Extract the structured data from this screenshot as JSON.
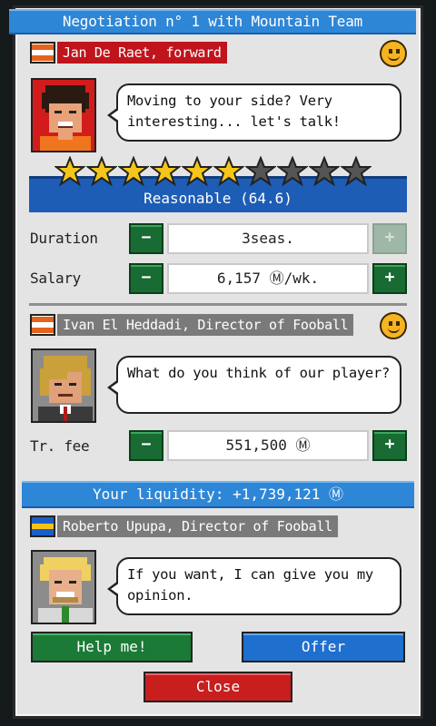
{
  "title": "Negotiation n° 1 with Mountain Team",
  "player": {
    "name": "Jan De Raet, forward",
    "speech": "Moving to your side? Very interesting... let's talk!",
    "stars_filled": 6,
    "stars_total": 10,
    "rating": "Reasonable (64.6)"
  },
  "contract": {
    "duration_label": "Duration",
    "duration_value": "3seas.",
    "salary_label": "Salary",
    "salary_value": "6,157 Ⓜ/wk.",
    "minus": "−",
    "plus": "+"
  },
  "director": {
    "name": "Ivan El Heddadi, Director of Fooball",
    "speech": "What do you think of our player?",
    "fee_label": "Tr. fee",
    "fee_value": "551,500 Ⓜ"
  },
  "liquidity": "Your liquidity: +1,739,121 Ⓜ",
  "advisor": {
    "name": "Roberto Upupa, Director of Fooball",
    "speech": "If you want, I can give you my opinion."
  },
  "buttons": {
    "help": "Help me!",
    "offer": "Offer",
    "close": "Close"
  },
  "colors": {
    "player_tag": "#c0141c",
    "director_tag": "#7a7a7a",
    "advisor_tag": "#7a7a7a",
    "title_blue": "#2e86d6",
    "rating_blue": "#1e5db6",
    "button_green": "#186b32"
  },
  "icons": {
    "mood_player": "smiley-icon",
    "mood_director": "smiley-icon",
    "player_flag": "flag-icon",
    "director_flag": "flag-icon",
    "advisor_flag": "flag-icon"
  }
}
